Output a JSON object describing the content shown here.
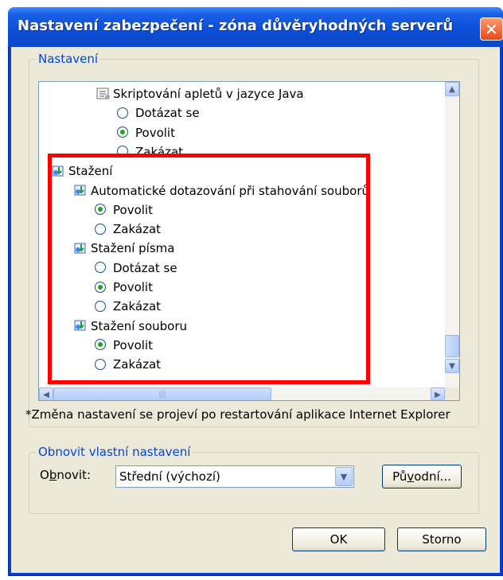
{
  "window": {
    "title": "Nastavení zabezpečení - zóna důvěryhodných serverů",
    "close_label": "✕"
  },
  "settings_group": {
    "label": "Nastavení"
  },
  "tree": [
    {
      "type": "category",
      "label": "Skriptování apletů v jazyce Java",
      "indent": 2,
      "icon": "script-settings-icon"
    },
    {
      "type": "option",
      "label": "Dotázat se",
      "indent": 3,
      "checked": false
    },
    {
      "type": "option",
      "label": "Povolit",
      "indent": 3,
      "checked": true
    },
    {
      "type": "option",
      "label": "Zakázat",
      "indent": 3,
      "checked": false
    },
    {
      "type": "category",
      "label": "Stažení",
      "indent": 0,
      "icon": "download-settings-icon"
    },
    {
      "type": "category",
      "label": "Automatické dotazování při stahování souborů",
      "indent": 1,
      "icon": "download-settings-icon"
    },
    {
      "type": "option",
      "label": "Povolit",
      "indent": 2,
      "checked": true
    },
    {
      "type": "option",
      "label": "Zakázat",
      "indent": 2,
      "checked": false
    },
    {
      "type": "category",
      "label": "Stažení písma",
      "indent": 1,
      "icon": "download-settings-icon"
    },
    {
      "type": "option",
      "label": "Dotázat se",
      "indent": 2,
      "checked": false
    },
    {
      "type": "option",
      "label": "Povolit",
      "indent": 2,
      "checked": true
    },
    {
      "type": "option",
      "label": "Zakázat",
      "indent": 2,
      "checked": false
    },
    {
      "type": "category",
      "label": "Stažení souboru",
      "indent": 1,
      "icon": "download-settings-icon"
    },
    {
      "type": "option",
      "label": "Povolit",
      "indent": 2,
      "checked": true
    },
    {
      "type": "option",
      "label": "Zakázat",
      "indent": 2,
      "checked": false
    }
  ],
  "note": "*Změna nastavení se projeví po restartování aplikace Internet Explorer",
  "reset_group": {
    "label": "Obnovit vlastní nastavení",
    "reset_label_before": "O",
    "reset_label_underlined": "b",
    "reset_label_after": "novit:",
    "selected": "Střední (výchozí)",
    "original_before": "Pů",
    "original_underlined": "v",
    "original_after": "odní..."
  },
  "buttons": {
    "ok": "OK",
    "cancel": "Storno"
  },
  "colors": {
    "titlebar": "#0c4fd8",
    "group_label": "#0046d5",
    "highlight": "#ff0000",
    "face": "#ece9d8"
  }
}
